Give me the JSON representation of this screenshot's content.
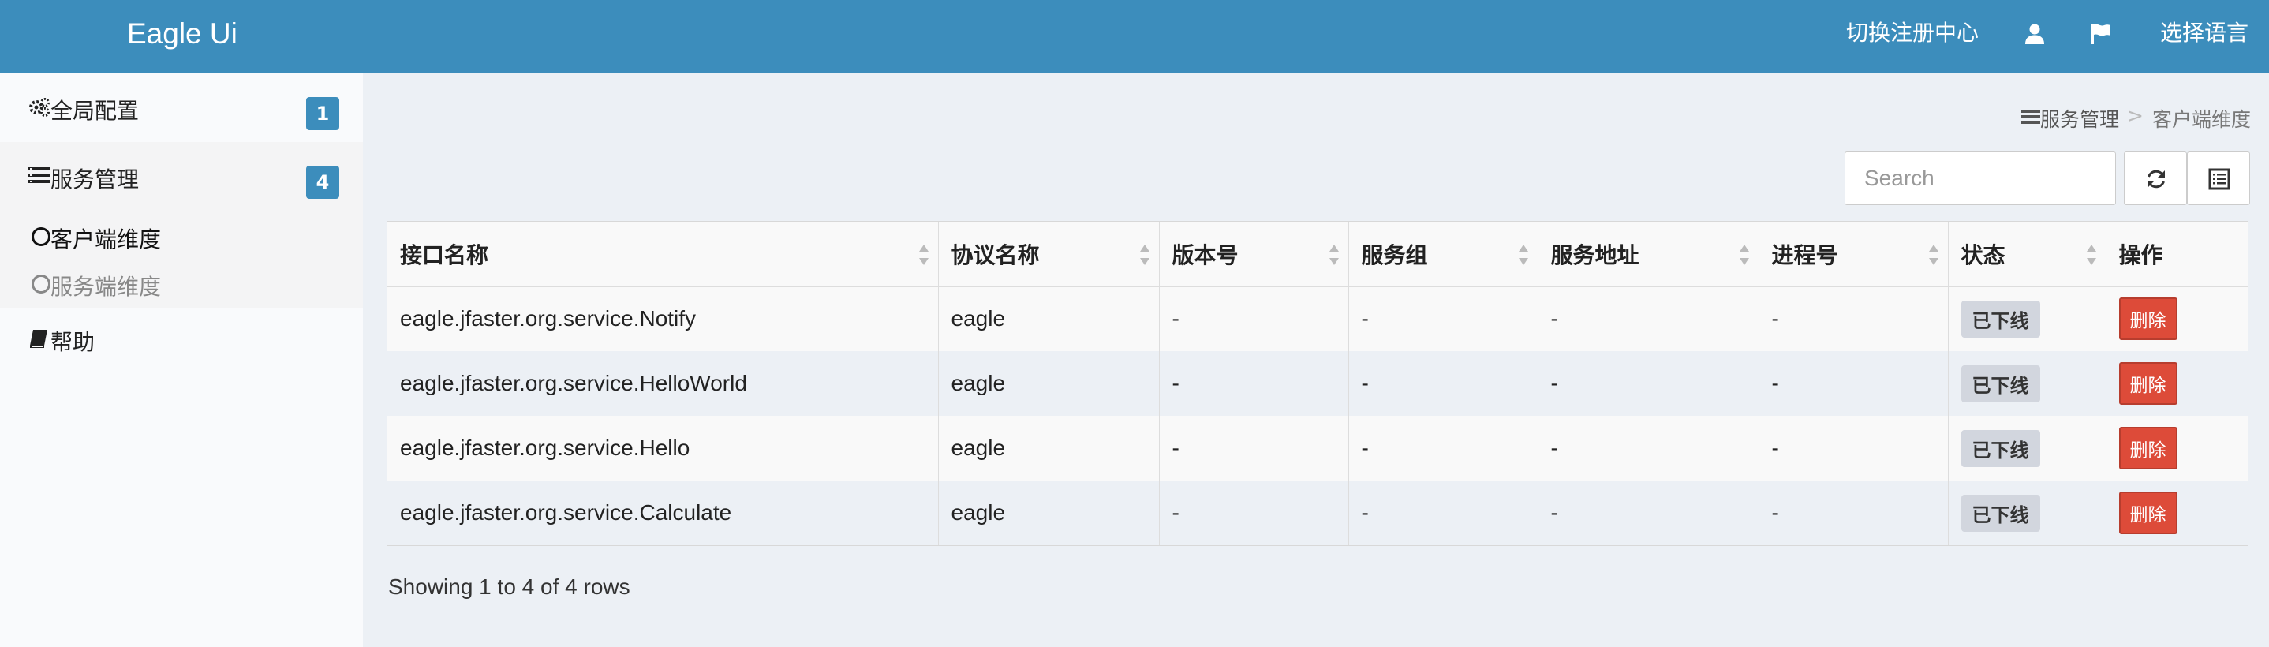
{
  "header": {
    "logo": "Eagle Ui",
    "switch_registry": "切换注册中心",
    "language": "选择语言",
    "user_icon": "user-icon",
    "flag_icon": "flag-icon"
  },
  "sidebar": {
    "items": [
      {
        "label": "全局配置",
        "badge": "1",
        "icon": "gears-icon"
      },
      {
        "label": "服务管理",
        "badge": "4",
        "icon": "list-icon"
      },
      {
        "label": "帮助",
        "icon": "book-icon"
      }
    ],
    "submenu": [
      {
        "label": "客户端维度",
        "active": true
      },
      {
        "label": "服务端维度",
        "active": false
      }
    ]
  },
  "breadcrumb": {
    "parent": "服务管理",
    "separator": ">",
    "current": "客户端维度"
  },
  "toolbar": {
    "search_placeholder": "Search",
    "refresh_icon": "refresh-icon",
    "columns_icon": "columns-icon"
  },
  "table": {
    "columns": [
      "接口名称",
      "协议名称",
      "版本号",
      "服务组",
      "服务地址",
      "进程号",
      "状态",
      "操作"
    ],
    "rows": [
      {
        "interface": "eagle.jfaster.org.service.Notify",
        "protocol": "eagle",
        "version": "-",
        "group": "-",
        "address": "-",
        "pid": "-",
        "status": "已下线",
        "action": "删除"
      },
      {
        "interface": "eagle.jfaster.org.service.HelloWorld",
        "protocol": "eagle",
        "version": "-",
        "group": "-",
        "address": "-",
        "pid": "-",
        "status": "已下线",
        "action": "删除"
      },
      {
        "interface": "eagle.jfaster.org.service.Hello",
        "protocol": "eagle",
        "version": "-",
        "group": "-",
        "address": "-",
        "pid": "-",
        "status": "已下线",
        "action": "删除"
      },
      {
        "interface": "eagle.jfaster.org.service.Calculate",
        "protocol": "eagle",
        "version": "-",
        "group": "-",
        "address": "-",
        "pid": "-",
        "status": "已下线",
        "action": "删除"
      }
    ]
  },
  "pagination": {
    "info": "Showing 1 to 4 of 4 rows"
  },
  "colors": {
    "header": "#3c8dbc",
    "badge": "#3c8dbc",
    "delete": "#dd4b39",
    "status_off": "#d2d6de"
  }
}
